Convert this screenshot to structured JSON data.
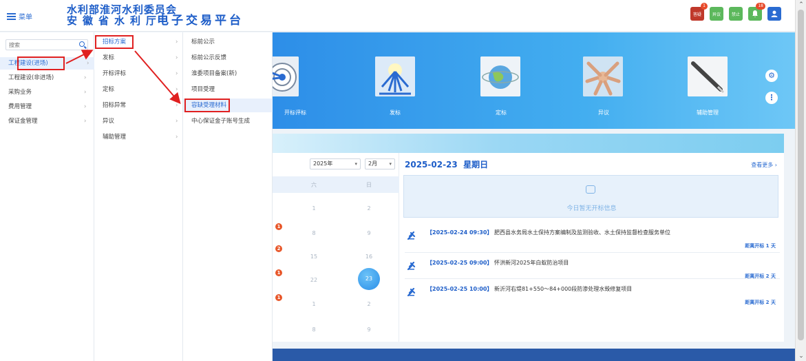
{
  "header": {
    "menu_label": "菜单",
    "org_line1": "水利部淮河水利委员会",
    "org_line2": "安徽省水利厅",
    "platform_title": "电子交易平台",
    "icons": [
      {
        "name": "reply-icon",
        "label": "答疑",
        "badge": "",
        "color": "#c0392b"
      },
      {
        "name": "objection-icon",
        "label": "异议",
        "badge": "",
        "color": "#5cb85c"
      },
      {
        "name": "ban-icon",
        "label": "禁止",
        "badge": "",
        "color": "#5cb85c"
      },
      {
        "name": "bell-icon",
        "label": "",
        "badge": "18",
        "color": "#5cb85c"
      },
      {
        "name": "user-icon",
        "label": "",
        "badge": "",
        "color": "#2a6bd1"
      }
    ],
    "reply_badge": "1"
  },
  "search": {
    "placeholder": "搜索"
  },
  "menu1": {
    "items": [
      "工程建设(进场)",
      "工程建设(非进场)",
      "采购业务",
      "费用管理",
      "保证金管理"
    ]
  },
  "menu2": {
    "items": [
      "招标方案",
      "发标",
      "开标评标",
      "定标",
      "招标异常",
      "异议",
      "辅助管理"
    ]
  },
  "menu3": {
    "items": [
      "标前公示",
      "标前公示反馈",
      "淮委项目备案(新)",
      "项目受理",
      "容缺受理材料",
      "中心保证金子账号生成"
    ]
  },
  "tiles": [
    "开标评标",
    "发标",
    "定标",
    "异议",
    "辅助管理"
  ],
  "calendar": {
    "year": "2025年",
    "month": "2月",
    "head": [
      "六",
      "日"
    ],
    "rows": [
      [
        "1",
        "2"
      ],
      [
        "8",
        "9"
      ],
      [
        "15",
        "16"
      ],
      [
        "22",
        "23"
      ],
      [
        "1",
        "2"
      ],
      [
        "8",
        "9"
      ]
    ],
    "markers": [
      "1",
      "2",
      "1",
      "1"
    ]
  },
  "schedule": {
    "date": "2025-02-23",
    "weekday": "星期日",
    "more": "查看更多",
    "empty_text": "今日暂无开标信息",
    "news": [
      {
        "time": "【2025-02-24 09:30】",
        "title": "肥西县水务局水土保持方案编制及监测验收、水土保持监督检查服务单位",
        "left": "距离开标 1 天"
      },
      {
        "time": "【2025-02-25 09:00】",
        "title": "怀洪新河2025年白蚁防治项目",
        "left": "距离开标 2 天"
      },
      {
        "time": "【2025-02-25 10:00】",
        "title": "新沂河右堤81+550～84+000段防渗处理水毁修复项目",
        "left": "距离开标 2 天"
      }
    ]
  }
}
